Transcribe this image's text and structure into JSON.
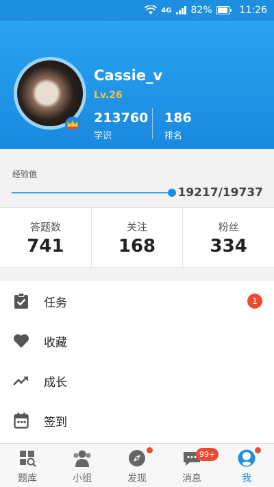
{
  "status_bar": {
    "network": "4G",
    "battery": "82%",
    "time": "11:26"
  },
  "profile": {
    "username": "Cassie_v",
    "level": "Lv.26",
    "knowledge_value": "213760",
    "knowledge_label": "学识",
    "rank_value": "186",
    "rank_label": "排名"
  },
  "experience": {
    "label": "经验值",
    "value_text": "19217/19737",
    "current": 19217,
    "max": 19737
  },
  "counts": [
    {
      "label": "答题数",
      "value": "741"
    },
    {
      "label": "关注",
      "value": "168"
    },
    {
      "label": "粉丝",
      "value": "334"
    }
  ],
  "menu": [
    {
      "label": "任务",
      "icon": "clipboard-check-icon",
      "badge": "1"
    },
    {
      "label": "收藏",
      "icon": "heart-icon"
    },
    {
      "label": "成长",
      "icon": "trending-up-icon"
    },
    {
      "label": "签到",
      "icon": "calendar-icon"
    }
  ],
  "tabs": [
    {
      "label": "题库",
      "icon": "grid-search-icon"
    },
    {
      "label": "小组",
      "icon": "group-icon"
    },
    {
      "label": "发现",
      "icon": "compass-icon"
    },
    {
      "label": "消息",
      "icon": "chat-icon",
      "badge": "99+"
    },
    {
      "label": "我",
      "icon": "person-icon",
      "active": true
    }
  ],
  "colors": {
    "primary": "#1e8fe0",
    "badge": "#ee4a32",
    "level": "#f6c244"
  }
}
